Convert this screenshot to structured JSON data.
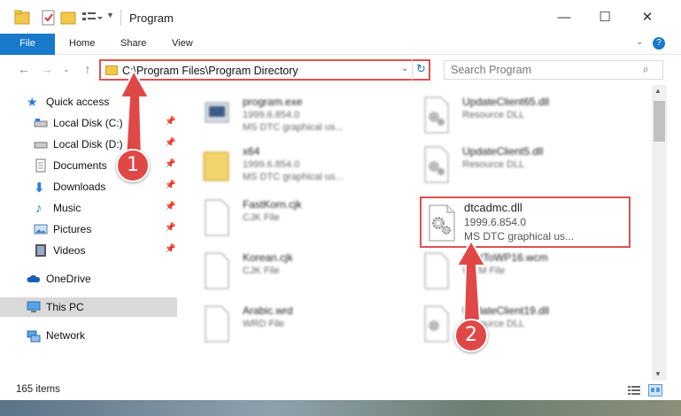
{
  "window": {
    "title": "Program",
    "minimize_glyph": "—",
    "maximize_glyph": "☐",
    "close_glyph": "✕"
  },
  "ribbon": {
    "tabs": [
      "File",
      "Home",
      "Share",
      "View"
    ]
  },
  "address": {
    "path": "C:\\Program Files\\Program Directory",
    "search_placeholder": "Search Program"
  },
  "nav": {
    "items": [
      {
        "label": "Quick access",
        "icon": "star-icon"
      },
      {
        "label": "Local Disk (C:)",
        "icon": "drive-icon"
      },
      {
        "label": "Local Disk (D:)",
        "icon": "drive-icon"
      },
      {
        "label": "Documents",
        "icon": "documents-icon"
      },
      {
        "label": "Downloads",
        "icon": "download-icon"
      },
      {
        "label": "Music",
        "icon": "music-icon"
      },
      {
        "label": "Pictures",
        "icon": "pictures-icon"
      },
      {
        "label": "Videos",
        "icon": "videos-icon"
      },
      {
        "label": "OneDrive",
        "icon": "cloud-icon"
      },
      {
        "label": "This PC",
        "icon": "computer-icon"
      },
      {
        "label": "Network",
        "icon": "network-icon"
      }
    ]
  },
  "files": {
    "left": [
      {
        "name": "program.exe",
        "line1": "1999.6.854.0",
        "line2": "MS DTC graphical us...",
        "icon": "exe-icon"
      },
      {
        "name": "x64",
        "line1": "1999.6.854.0",
        "line2": "MS DTC graphical us...",
        "icon": "folder-icon"
      },
      {
        "name": "FastKorn.cjk",
        "line1": "CJK File",
        "line2": "",
        "icon": "file-icon"
      },
      {
        "name": "Korean.cjk",
        "line1": "CJK File",
        "line2": "",
        "icon": "file-icon"
      },
      {
        "name": "Arabic.wrd",
        "line1": "WRD File",
        "line2": "",
        "icon": "file-icon"
      }
    ],
    "right": [
      {
        "name": "UpdateClient65.dll",
        "line1": "Resource DLL",
        "line2": "",
        "icon": "dll-icon"
      },
      {
        "name": "UpdateClient5.dll",
        "line1": "Resource DLL",
        "line2": "",
        "icon": "dll-icon"
      },
      {
        "name": "",
        "line1": "",
        "line2": "",
        "icon": "dll-icon"
      },
      {
        "name": "FastToWP16.wcm",
        "line1": "WCM File",
        "line2": "",
        "icon": "file-icon"
      },
      {
        "name": "UpdateClient19.dll",
        "line1": "Resource DLL",
        "line2": "",
        "icon": "dll-icon"
      }
    ],
    "highlighted": {
      "name": "dtcadmc.dll",
      "line1": "1999.6.854.0",
      "line2": "MS DTC graphical us..."
    }
  },
  "status": {
    "count": "165 items"
  },
  "callouts": [
    "1",
    "2"
  ],
  "colors": {
    "accent": "#1979ca",
    "highlight": "#e05050"
  }
}
